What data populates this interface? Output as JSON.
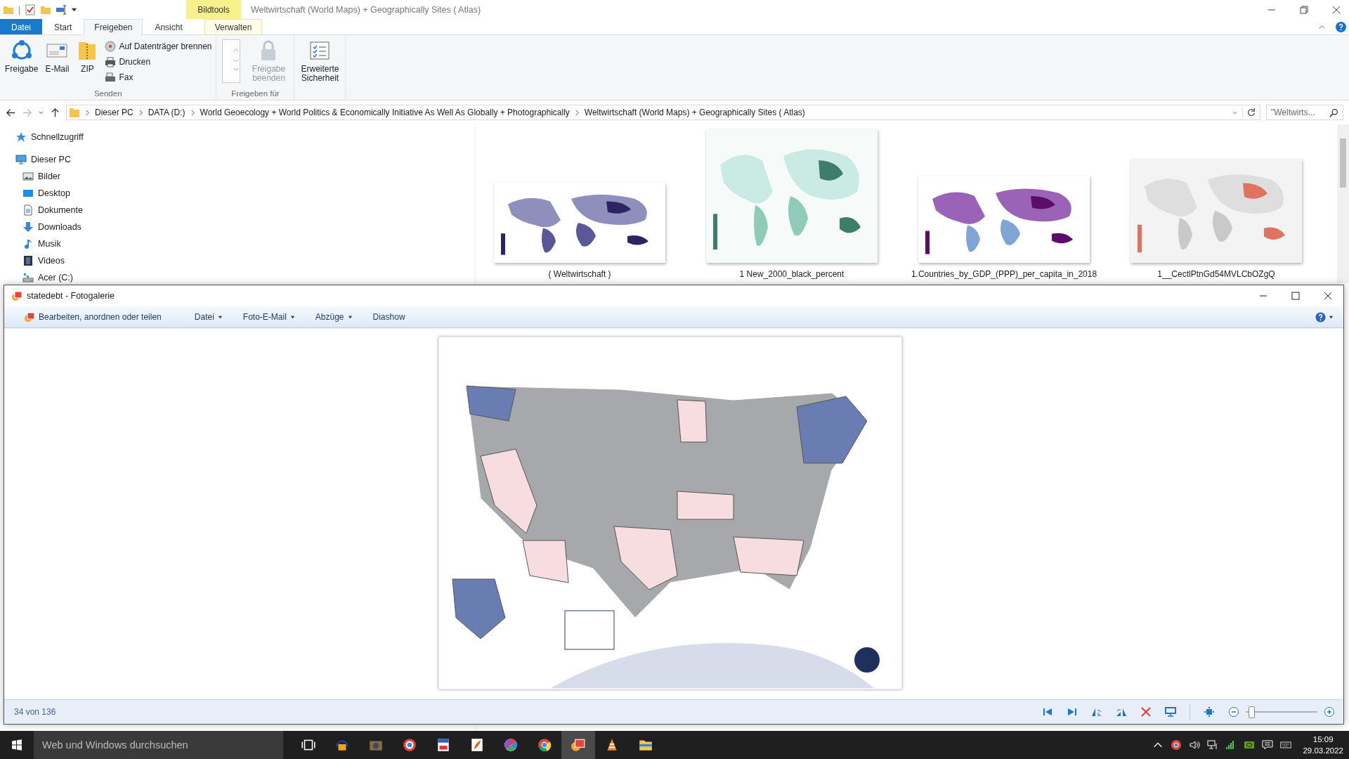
{
  "explorer": {
    "quick_access_separator": "|",
    "context_tab": "Bildtools",
    "title": "Weltwirtschaft (World Maps) + Geographically Sites ( Atlas)",
    "tabs": [
      {
        "label": "Datei",
        "kind": "file",
        "selected": false
      },
      {
        "label": "Start",
        "kind": "tab",
        "selected": false
      },
      {
        "label": "Freigeben",
        "kind": "tab",
        "selected": true
      },
      {
        "label": "Ansicht",
        "kind": "tab",
        "selected": false
      },
      {
        "label": "Verwalten",
        "kind": "context",
        "selected": false
      }
    ],
    "ribbon": [
      {
        "label": "Senden",
        "items": [
          {
            "kind": "large",
            "label": "Freigabe",
            "disabled": false
          },
          {
            "kind": "large",
            "label": "E-Mail",
            "disabled": false
          },
          {
            "kind": "large",
            "label": "ZIP",
            "disabled": false
          },
          {
            "kind": "stack",
            "items": [
              {
                "label": "Auf Datenträger brennen",
                "disabled": false
              },
              {
                "label": "Drucken",
                "disabled": false
              },
              {
                "label": "Fax",
                "disabled": false
              }
            ]
          }
        ]
      },
      {
        "label": "Freigeben für",
        "items": [
          {
            "kind": "list"
          },
          {
            "kind": "large",
            "label": "Freigabe beenden",
            "disabled": true
          }
        ]
      },
      {
        "items": [
          {
            "kind": "large",
            "label": "Erweiterte Sicherheit",
            "disabled": false
          }
        ]
      }
    ],
    "breadcrumb": [
      "Dieser PC",
      "DATA (D:)",
      "World Geoecology + World Politics & Economically Initiative As Well As Globally + Photographically",
      "Weltwirtschaft (World Maps) + Geographically Sites ( Atlas)"
    ],
    "search": {
      "value": "\"Weltwirts..."
    },
    "nav": [
      {
        "label": "Schnellzugriff"
      },
      {
        "label": "Dieser PC",
        "children": [
          {
            "label": "Bilder"
          },
          {
            "label": "Desktop"
          },
          {
            "label": "Dokumente"
          },
          {
            "label": "Downloads"
          },
          {
            "label": "Musik"
          },
          {
            "label": "Videos"
          },
          {
            "label": "Acer (C:)"
          }
        ]
      }
    ],
    "thumbnails": [
      {
        "caption": "( Weltwirtschaft )",
        "kind": "picture"
      },
      {
        "caption": "1 New_2000_black_percent",
        "kind": "picture"
      },
      {
        "caption": "1.Countries_by_GDP_(PPP)_per_capita_in_2018",
        "kind": "picture"
      },
      {
        "caption": "1__CectlPtnGd54MVLCbOZgQ",
        "kind": "picture"
      }
    ]
  },
  "gallery": {
    "title": "statedebt - Fotogalerie",
    "menu": [
      {
        "label": "Bearbeiten, anordnen oder teilen",
        "dropdown": false
      },
      {
        "label": "Datei",
        "dropdown": true
      },
      {
        "label": "Foto-E-Mail",
        "dropdown": true
      },
      {
        "label": "Abzüge",
        "dropdown": true
      },
      {
        "label": "Diashow",
        "dropdown": false
      }
    ],
    "position": "34 von 136",
    "zoom": {
      "level": 0.04
    }
  },
  "taskbar": {
    "search_placeholder": "Web und Windows durchsuchen",
    "time": "15:09",
    "date": "29.03.2022"
  }
}
